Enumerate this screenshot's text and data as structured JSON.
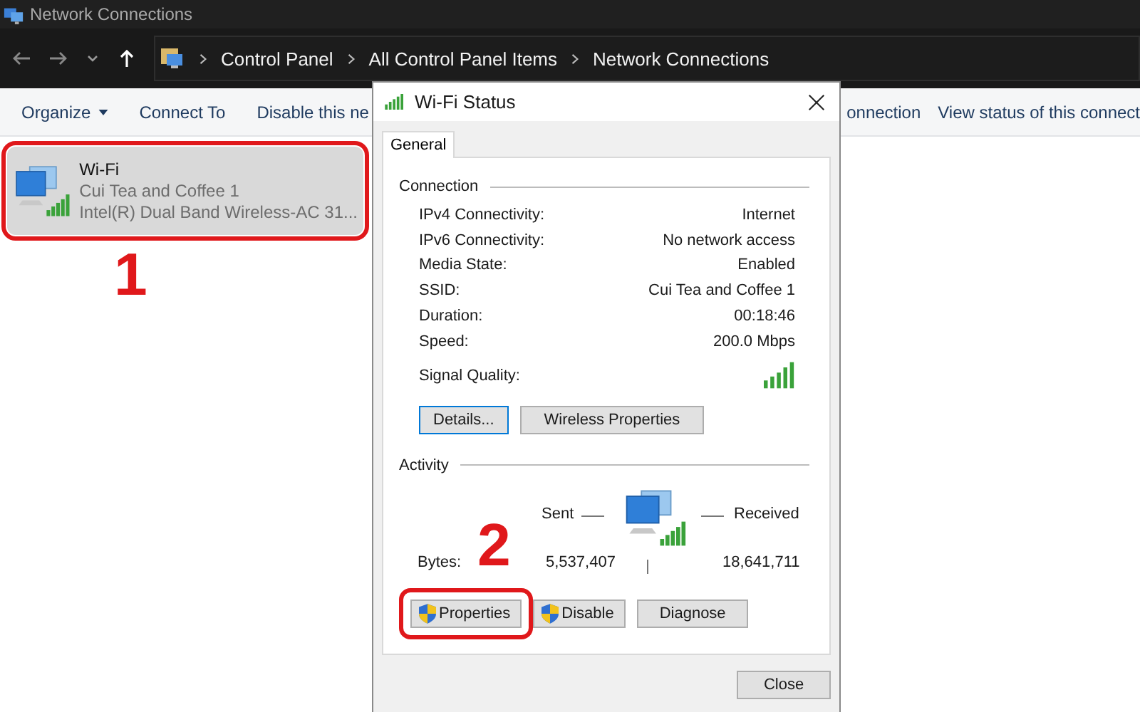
{
  "window": {
    "title": "Network Connections"
  },
  "breadcrumbs": [
    "Control Panel",
    "All Control Panel Items",
    "Network Connections"
  ],
  "toolbar": [
    {
      "label": "Organize",
      "kind": "menu"
    },
    {
      "label": "Connect To",
      "kind": "plain"
    },
    {
      "label": "Disable this ne",
      "kind": "plain"
    },
    {
      "label": "onnection",
      "kind": "right"
    },
    {
      "label": "View status of this connect",
      "kind": "right"
    }
  ],
  "connections": [
    {
      "name": "Wi-Fi",
      "network": "Cui Tea and Coffee 1",
      "adapter": "Intel(R) Dual Band Wireless-AC 31...",
      "selected": true,
      "highlighted": true
    }
  ],
  "dialog": {
    "title": "Wi-Fi Status",
    "tabs": [
      {
        "label": "General",
        "selected": true
      }
    ],
    "connection": {
      "heading": "Connection",
      "rows": [
        {
          "label": "IPv4 Connectivity:",
          "value": "Internet"
        },
        {
          "label": "IPv6 Connectivity:",
          "value": "No network access"
        },
        {
          "label": "Media State:",
          "value": "Enabled"
        },
        {
          "label": "SSID:",
          "value": "Cui Tea and Coffee 1"
        },
        {
          "label": "Duration:",
          "value": "00:18:46"
        },
        {
          "label": "Speed:",
          "value": "200.0 Mbps"
        }
      ],
      "signal_label": "Signal Quality:",
      "buttons": [
        {
          "label": "Details...",
          "default": true
        },
        {
          "label": "Wireless Properties",
          "default": false
        }
      ]
    },
    "activity": {
      "heading": "Activity",
      "sent_label": "Sent",
      "received_label": "Received",
      "bytes_label": "Bytes:",
      "sent": "5,537,407",
      "received": "18,641,711"
    },
    "actions": [
      {
        "label": "Properties",
        "kind": "shield",
        "highlighted": true
      },
      {
        "label": "Disable",
        "kind": "shield",
        "highlighted": false
      },
      {
        "label": "Diagnose",
        "kind": "plain",
        "highlighted": false
      }
    ],
    "close_button": "Close"
  },
  "annotations": [
    {
      "label": "1",
      "kind": "step"
    },
    {
      "label": "2",
      "kind": "step"
    }
  ]
}
